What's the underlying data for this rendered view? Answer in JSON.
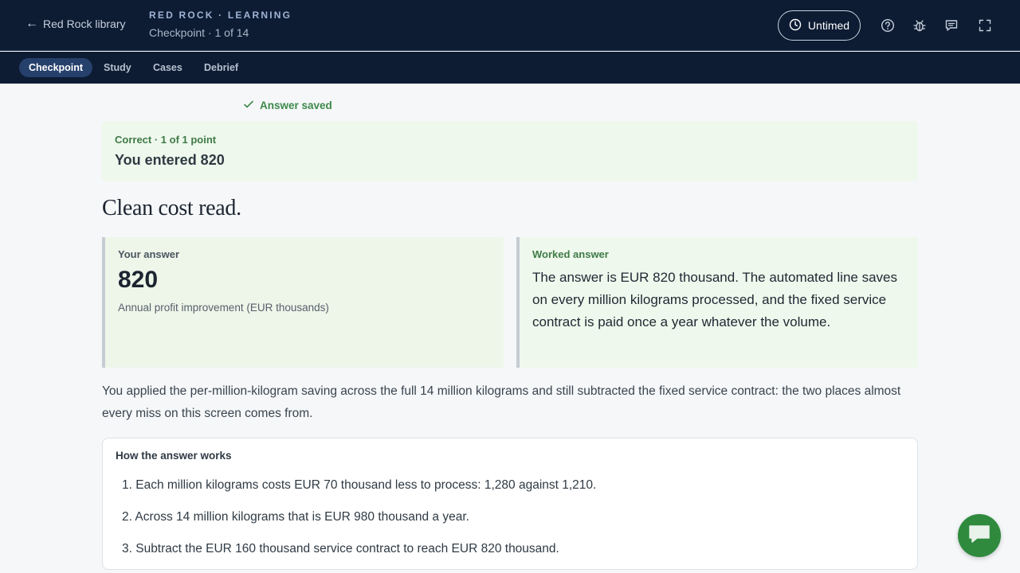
{
  "header": {
    "back_label": "Red Rock library",
    "brand": "RED ROCK · LEARNING",
    "subtitle": "Checkpoint · 1 of 14",
    "timer_label": "Untimed"
  },
  "tabs": [
    {
      "label": "Checkpoint",
      "active": true
    },
    {
      "label": "Study",
      "active": false
    },
    {
      "label": "Cases",
      "active": false
    },
    {
      "label": "Debrief",
      "active": false
    }
  ],
  "status": {
    "saved_label": "Answer saved"
  },
  "result": {
    "label": "Correct · 1 of 1 point",
    "value": "You entered 820"
  },
  "headline": "Clean cost read.",
  "your_answer": {
    "label": "Your answer",
    "value": "820",
    "caption": "Annual profit improvement (EUR thousands)"
  },
  "worked_answer": {
    "label": "Worked answer",
    "text": "The answer is EUR 820 thousand. The automated line saves on every million kilograms processed, and the fixed service contract is paid once a year whatever the volume."
  },
  "explanation": "You applied the per-million-kilogram saving across the full 14 million kilograms and still subtracted the fixed service contract: the two places almost every miss on this screen comes from.",
  "how_it_works": {
    "title": "How the answer works",
    "steps": [
      "1. Each million kilograms costs EUR 70 thousand less to process: 1,280 against 1,210.",
      "2. Across 14 million kilograms that is EUR 980 thousand a year.",
      "3. Subtract the EUR 160 thousand service contract to reach EUR 820 thousand."
    ]
  },
  "icons": {
    "back": "arrow-left-icon",
    "timer": "clock-icon",
    "help": "help-icon",
    "bug": "bug-icon",
    "feedback": "comment-icon",
    "fullscreen": "fullscreen-icon",
    "saved": "check-icon",
    "chat": "chat-icon"
  },
  "colors": {
    "header_bg": "#0d1b33",
    "active_tab": "#26406c",
    "success": "#3d8a4a",
    "success_bg": "#eef8ec",
    "chat_fab": "#2f8a3e"
  }
}
